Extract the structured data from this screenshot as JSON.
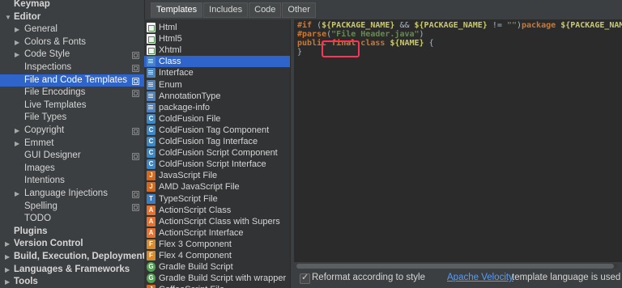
{
  "tree": {
    "items": [
      {
        "label": "Keymap",
        "level": 0,
        "arrow": "",
        "bold": true,
        "project": false,
        "selected": false
      },
      {
        "label": "Editor",
        "level": 0,
        "arrow": "open",
        "bold": true,
        "project": false,
        "selected": false
      },
      {
        "label": "General",
        "level": 1,
        "arrow": "closed",
        "bold": false,
        "project": false,
        "selected": false
      },
      {
        "label": "Colors & Fonts",
        "level": 1,
        "arrow": "closed",
        "bold": false,
        "project": false,
        "selected": false
      },
      {
        "label": "Code Style",
        "level": 1,
        "arrow": "closed",
        "bold": false,
        "project": true,
        "selected": false
      },
      {
        "label": "Inspections",
        "level": 1,
        "arrow": "",
        "bold": false,
        "project": true,
        "selected": false
      },
      {
        "label": "File and Code Templates",
        "level": 1,
        "arrow": "",
        "bold": false,
        "project": true,
        "selected": true
      },
      {
        "label": "File Encodings",
        "level": 1,
        "arrow": "",
        "bold": false,
        "project": true,
        "selected": false
      },
      {
        "label": "Live Templates",
        "level": 1,
        "arrow": "",
        "bold": false,
        "project": false,
        "selected": false
      },
      {
        "label": "File Types",
        "level": 1,
        "arrow": "",
        "bold": false,
        "project": false,
        "selected": false
      },
      {
        "label": "Copyright",
        "level": 1,
        "arrow": "closed",
        "bold": false,
        "project": true,
        "selected": false
      },
      {
        "label": "Emmet",
        "level": 1,
        "arrow": "closed",
        "bold": false,
        "project": false,
        "selected": false
      },
      {
        "label": "GUI Designer",
        "level": 1,
        "arrow": "",
        "bold": false,
        "project": true,
        "selected": false
      },
      {
        "label": "Images",
        "level": 1,
        "arrow": "",
        "bold": false,
        "project": false,
        "selected": false
      },
      {
        "label": "Intentions",
        "level": 1,
        "arrow": "",
        "bold": false,
        "project": false,
        "selected": false
      },
      {
        "label": "Language Injections",
        "level": 1,
        "arrow": "closed",
        "bold": false,
        "project": true,
        "selected": false
      },
      {
        "label": "Spelling",
        "level": 1,
        "arrow": "",
        "bold": false,
        "project": true,
        "selected": false
      },
      {
        "label": "TODO",
        "level": 1,
        "arrow": "",
        "bold": false,
        "project": false,
        "selected": false
      },
      {
        "label": "Plugins",
        "level": 0,
        "arrow": "",
        "bold": true,
        "project": false,
        "selected": false
      },
      {
        "label": "Version Control",
        "level": 0,
        "arrow": "closed",
        "bold": true,
        "project": false,
        "selected": false
      },
      {
        "label": "Build, Execution, Deployment",
        "level": 0,
        "arrow": "closed",
        "bold": true,
        "project": false,
        "selected": false
      },
      {
        "label": "Languages & Frameworks",
        "level": 0,
        "arrow": "closed",
        "bold": true,
        "project": false,
        "selected": false
      },
      {
        "label": "Tools",
        "level": 0,
        "arrow": "closed",
        "bold": true,
        "project": false,
        "selected": false
      }
    ]
  },
  "tabs": [
    {
      "label": "Templates",
      "active": true
    },
    {
      "label": "Includes",
      "active": false
    },
    {
      "label": "Code",
      "active": false
    },
    {
      "label": "Other",
      "active": false
    }
  ],
  "templates": [
    {
      "label": "Html",
      "icon": "html",
      "selected": false
    },
    {
      "label": "Html5",
      "icon": "html",
      "selected": false
    },
    {
      "label": "Xhtml",
      "icon": "html",
      "selected": false
    },
    {
      "label": "Class",
      "icon": "java",
      "selected": true
    },
    {
      "label": "Interface",
      "icon": "java",
      "selected": false
    },
    {
      "label": "Enum",
      "icon": "java",
      "selected": false
    },
    {
      "label": "AnnotationType",
      "icon": "java",
      "selected": false
    },
    {
      "label": "package-info",
      "icon": "java",
      "selected": false
    },
    {
      "label": "ColdFusion File",
      "icon": "cf",
      "selected": false
    },
    {
      "label": "ColdFusion Tag Component",
      "icon": "cf",
      "selected": false
    },
    {
      "label": "ColdFusion Tag Interface",
      "icon": "cf",
      "selected": false
    },
    {
      "label": "ColdFusion Script Component",
      "icon": "cf",
      "selected": false
    },
    {
      "label": "ColdFusion Script Interface",
      "icon": "cf",
      "selected": false
    },
    {
      "label": "JavaScript File",
      "icon": "js",
      "selected": false
    },
    {
      "label": "AMD JavaScript File",
      "icon": "js",
      "selected": false
    },
    {
      "label": "TypeScript File",
      "icon": "ts",
      "selected": false
    },
    {
      "label": "ActionScript Class",
      "icon": "as",
      "selected": false
    },
    {
      "label": "ActionScript Class with Supers",
      "icon": "as",
      "selected": false
    },
    {
      "label": "ActionScript Interface",
      "icon": "as",
      "selected": false
    },
    {
      "label": "Flex 3 Component",
      "icon": "flex",
      "selected": false
    },
    {
      "label": "Flex 4 Component",
      "icon": "flex",
      "selected": false
    },
    {
      "label": "Gradle Build Script",
      "icon": "gradle",
      "selected": false
    },
    {
      "label": "Gradle Build Script with wrapper",
      "icon": "gradle",
      "selected": false
    },
    {
      "label": "CoffeeScript File",
      "icon": "js",
      "selected": false
    }
  ],
  "editor": {
    "lines": [
      [
        {
          "t": "#if",
          "c": "kw"
        },
        {
          "t": " (",
          "c": "plain"
        },
        {
          "t": "${PACKAGE_NAME}",
          "c": "var"
        },
        {
          "t": " && ",
          "c": "plain"
        },
        {
          "t": "${PACKAGE_NAME}",
          "c": "var"
        },
        {
          "t": " != ",
          "c": "plain"
        },
        {
          "t": "\"\"",
          "c": "str"
        },
        {
          "t": ")",
          "c": "plain"
        },
        {
          "t": "package",
          "c": "kw"
        },
        {
          "t": " ",
          "c": "plain"
        },
        {
          "t": "${PACKAGE_NAME}",
          "c": "var"
        },
        {
          "t": ";#",
          "c": "plain"
        }
      ],
      [
        {
          "t": "#parse",
          "c": "kw"
        },
        {
          "t": "(",
          "c": "plain"
        },
        {
          "t": "\"File Header.java\"",
          "c": "str"
        },
        {
          "t": ")",
          "c": "plain"
        }
      ],
      [
        {
          "t": "public",
          "c": "kw"
        },
        {
          "t": " ",
          "c": "plain"
        },
        {
          "t": "final",
          "c": "kw"
        },
        {
          "t": " ",
          "c": "plain"
        },
        {
          "t": "class",
          "c": "kw"
        },
        {
          "t": " ",
          "c": "plain"
        },
        {
          "t": "${NAME}",
          "c": "var"
        },
        {
          "t": " {",
          "c": "plain"
        }
      ],
      [
        {
          "t": "}",
          "c": "plain"
        }
      ]
    ]
  },
  "bottom": {
    "reformat_label": "Reformat according to style",
    "reformat_checked": true,
    "velocity_link": "Apache Velocity",
    "velocity_rest": "template language is used"
  },
  "colors": {
    "selection": "#2f65ca",
    "highlight_box": "#ff3355",
    "link": "#589df6"
  }
}
